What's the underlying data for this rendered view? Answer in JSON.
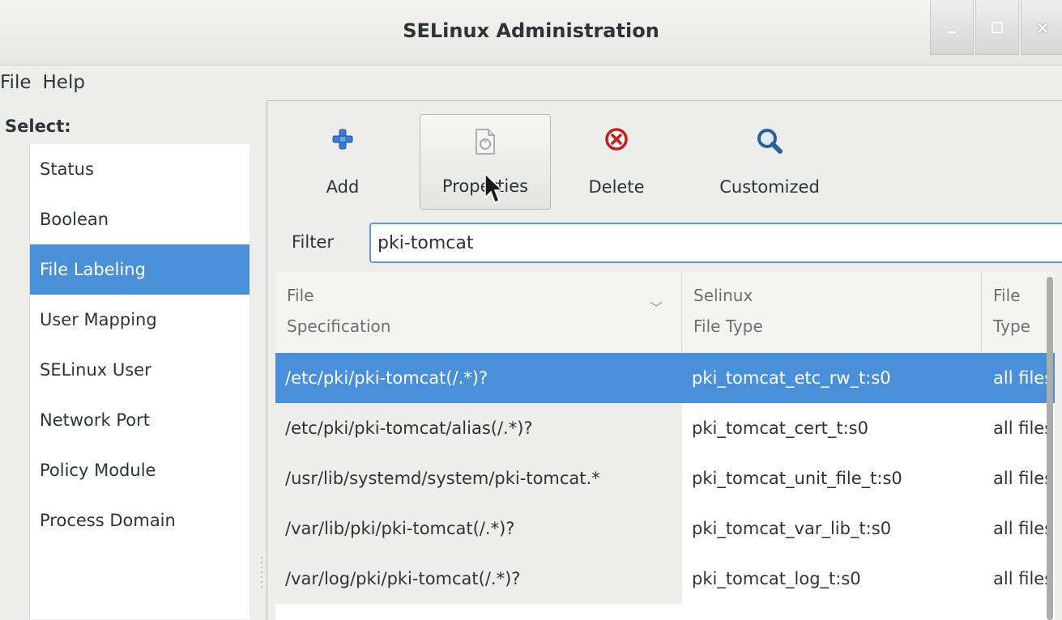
{
  "window": {
    "title": "SELinux Administration",
    "controls": {
      "minimize": "minimize-icon",
      "maximize": "maximize-icon",
      "close": "close-icon"
    }
  },
  "menu": {
    "items": [
      "File",
      "Help"
    ]
  },
  "sidebar": {
    "select_label": "Select:",
    "items": [
      {
        "label": "Status",
        "selected": false
      },
      {
        "label": "Boolean",
        "selected": false
      },
      {
        "label": "File Labeling",
        "selected": true
      },
      {
        "label": "User Mapping",
        "selected": false
      },
      {
        "label": "SELinux User",
        "selected": false
      },
      {
        "label": "Network Port",
        "selected": false
      },
      {
        "label": "Policy Module",
        "selected": false
      },
      {
        "label": "Process Domain",
        "selected": false
      }
    ]
  },
  "toolbar": {
    "add": {
      "label": "Add",
      "icon": "plus-icon"
    },
    "properties": {
      "label": "Properties",
      "icon": "properties-icon"
    },
    "delete": {
      "label": "Delete",
      "icon": "delete-icon"
    },
    "customized": {
      "label": "Customized",
      "icon": "magnifier-icon"
    }
  },
  "filter": {
    "label": "Filter",
    "value": "pki-tomcat"
  },
  "table": {
    "columns": [
      {
        "line1": "File",
        "line2": "Specification"
      },
      {
        "line1": "Selinux",
        "line2": "File Type"
      },
      {
        "line1": "File",
        "line2": "Type"
      }
    ],
    "rows": [
      {
        "spec": "/etc/pki/pki-tomcat(/.*)?",
        "type": "pki_tomcat_etc_rw_t:s0",
        "file_type": "all files",
        "selected": true
      },
      {
        "spec": "/etc/pki/pki-tomcat/alias(/.*)?",
        "type": "pki_tomcat_cert_t:s0",
        "file_type": "all files",
        "selected": false
      },
      {
        "spec": "/usr/lib/systemd/system/pki-tomcat.*",
        "type": "pki_tomcat_unit_file_t:s0",
        "file_type": "all files",
        "selected": false
      },
      {
        "spec": "/var/lib/pki/pki-tomcat(/.*)?",
        "type": "pki_tomcat_var_lib_t:s0",
        "file_type": "all files",
        "selected": false
      },
      {
        "spec": "/var/log/pki/pki-tomcat(/.*)?",
        "type": "pki_tomcat_log_t:s0",
        "file_type": "all files",
        "selected": false
      }
    ]
  },
  "colors": {
    "selection": "#4a90d9",
    "add_icon": "#3a7bd5",
    "delete_icon": "#cc1a1a",
    "search_icon": "#2c5f9e"
  }
}
